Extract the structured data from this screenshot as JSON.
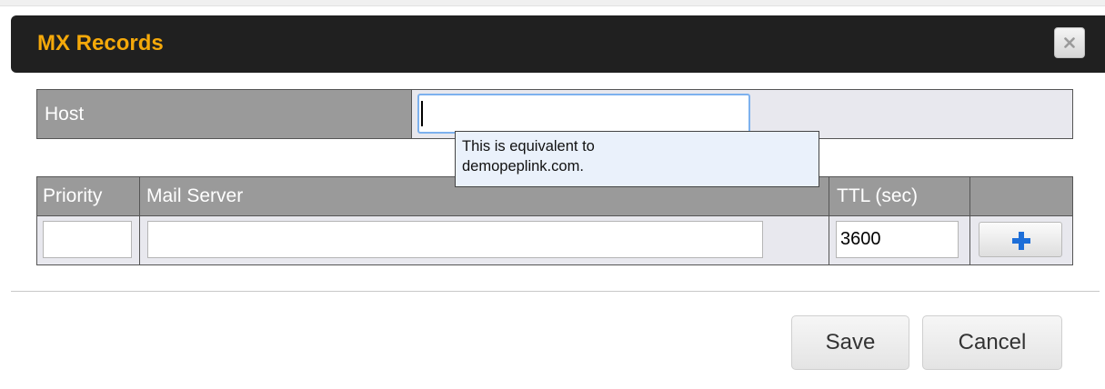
{
  "dialog": {
    "title": "MX Records",
    "close_icon": "close-icon"
  },
  "host": {
    "label": "Host",
    "value": "",
    "tooltip_line1": "This is equivalent to",
    "tooltip_line2": "demopeplink.com."
  },
  "mx_table": {
    "columns": {
      "priority": "Priority",
      "mail_server": "Mail Server",
      "ttl": "TTL (sec)"
    },
    "row": {
      "priority": "",
      "mail_server": "",
      "ttl": "3600"
    },
    "add_icon": "plus-icon"
  },
  "footer": {
    "save_label": "Save",
    "cancel_label": "Cancel"
  },
  "colors": {
    "title": "#f5a90a",
    "header_bg": "#202020",
    "table_header_bg": "#9a9a9a",
    "add_icon": "#1d6ed8"
  }
}
